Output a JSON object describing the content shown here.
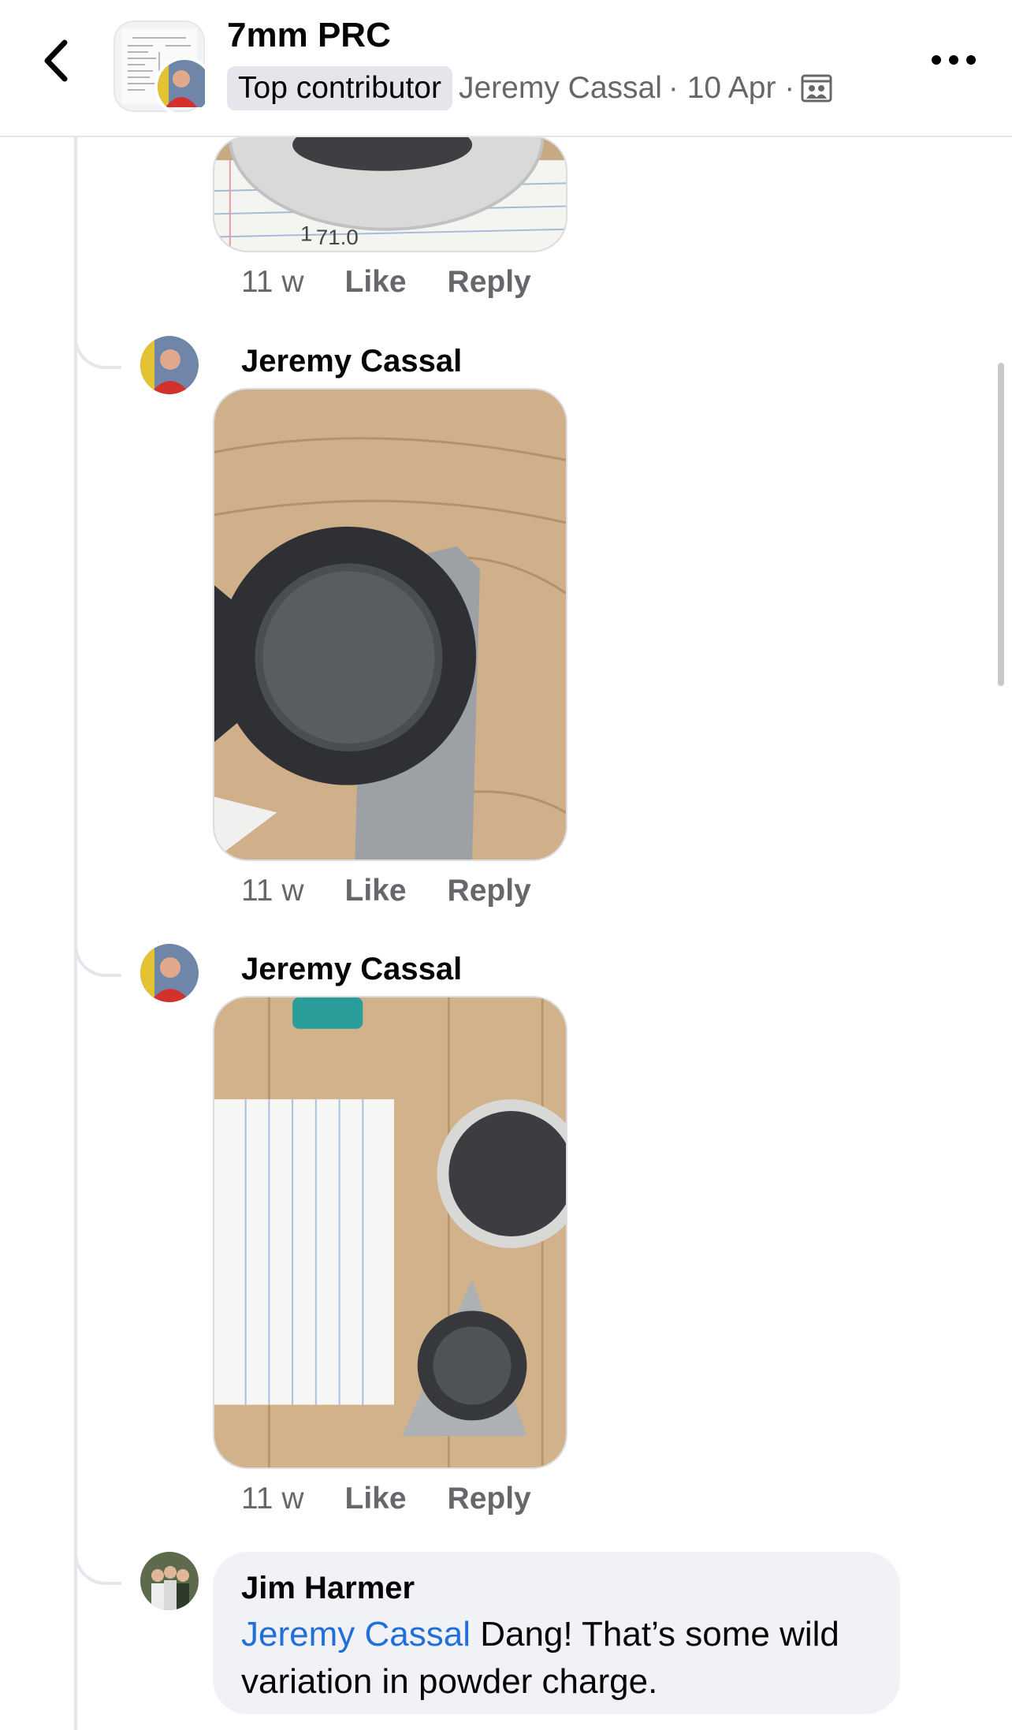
{
  "header": {
    "group_name": "7mm PRC",
    "badge": "Top contributor",
    "author": "Jeremy Cassal",
    "date_text": "· 10 Apr ·",
    "icons": {
      "back": "chevron-left-icon",
      "more": "more-horizontal-icon",
      "privacy": "members-group-icon"
    }
  },
  "comments": [
    {
      "time": "11 w",
      "like": "Like",
      "reply": "Reply"
    },
    {
      "author": "Jeremy Cassal",
      "time": "11 w",
      "like": "Like",
      "reply": "Reply"
    },
    {
      "author": "Jeremy Cassal",
      "time": "11 w",
      "like": "Like",
      "reply": "Reply"
    }
  ],
  "reply": {
    "author": "Jim Harmer",
    "mention": "Jeremy Cassal",
    "text": " Dang!  That’s some wild variation in powder charge."
  },
  "colors": {
    "accent": "#216fdb",
    "muted": "#65676b",
    "bubble": "#f0f2f5"
  }
}
